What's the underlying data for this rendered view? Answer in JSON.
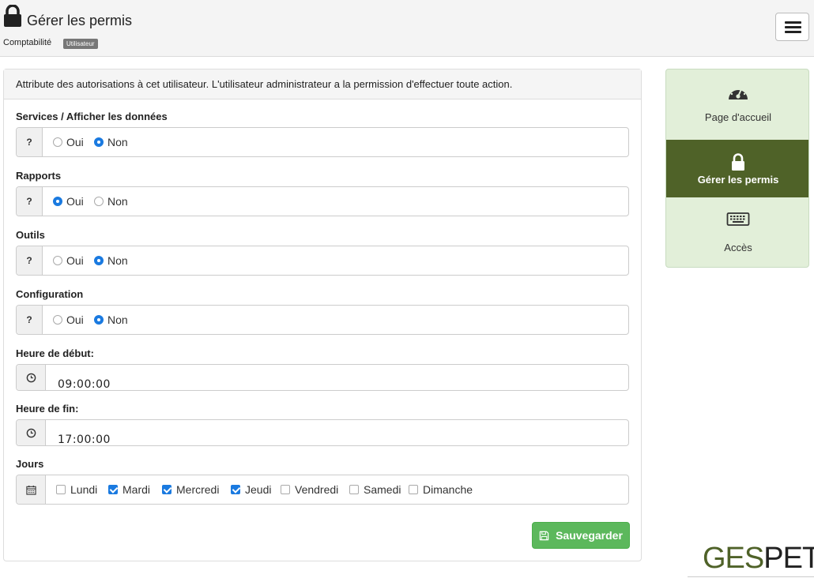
{
  "header": {
    "title": "Gérer les permis",
    "breadcrumb": "Comptabilité",
    "badge": "Utilisateur"
  },
  "panel": {
    "description": "Attribute des autorisations à cet utilisateur. L'utilisateur administrateur a la permission d'effectuer toute action.",
    "help_glyph": "?",
    "permissions": [
      {
        "label": "Services / Afficher les données",
        "yes": "Oui",
        "no": "Non",
        "selected": "Non"
      },
      {
        "label": "Rapports",
        "yes": "Oui",
        "no": "Non",
        "selected": "Oui"
      },
      {
        "label": "Outils",
        "yes": "Oui",
        "no": "Non",
        "selected": "Non"
      },
      {
        "label": "Configuration",
        "yes": "Oui",
        "no": "Non",
        "selected": "Non"
      }
    ],
    "start_time": {
      "label": "Heure de début:",
      "value": "09:00:00"
    },
    "end_time": {
      "label": "Heure de fin:",
      "value": "17:00:00"
    },
    "days": {
      "label": "Jours",
      "items": [
        {
          "name": "Lundi",
          "checked": false
        },
        {
          "name": "Mardi",
          "checked": true
        },
        {
          "name": "Mercredi",
          "checked": true
        },
        {
          "name": "Jeudi",
          "checked": true
        },
        {
          "name": "Vendredi",
          "checked": false
        },
        {
          "name": "Samedi",
          "checked": false
        },
        {
          "name": "Dimanche",
          "checked": false
        }
      ]
    },
    "save_label": "Sauvegarder"
  },
  "sidebar": {
    "items": [
      {
        "label": "Page d'accueil",
        "icon": "dashboard-icon",
        "active": false
      },
      {
        "label": "Gérer les permis",
        "icon": "lock-icon",
        "active": true
      },
      {
        "label": "Accès",
        "icon": "keyboard-icon",
        "active": false
      }
    ]
  },
  "logo": {
    "part1": "GES",
    "part2": "PET"
  },
  "colors": {
    "accent_green": "#4f6228",
    "sidebar_bg": "#e2efd9",
    "save_green": "#5cb85c",
    "radio_blue": "#1a7ae0"
  }
}
